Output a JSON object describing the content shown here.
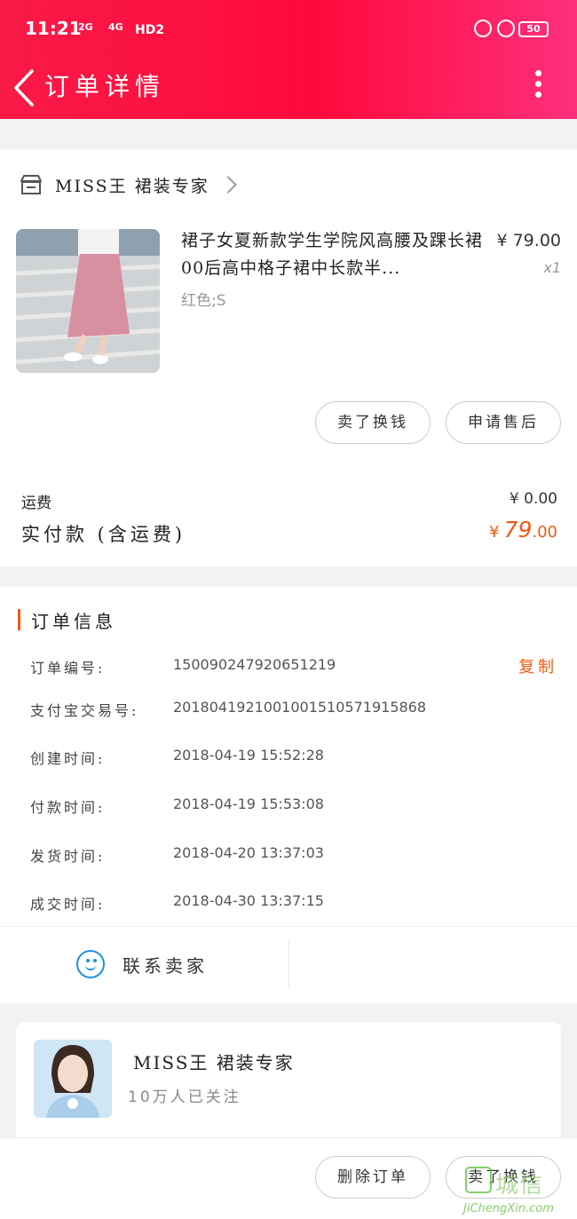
{
  "status_bar": {
    "time": "11:21",
    "signal1": "2G",
    "signal2": "4G",
    "hd": "HD2",
    "battery": "50"
  },
  "nav": {
    "title": "订单详情"
  },
  "store": {
    "name": "MISS王  裙装专家"
  },
  "product": {
    "title": "裙子女夏新款学生学院风高腰及踝长裙00后高中格子裙中长款半...",
    "sku": "红色;S",
    "price": "¥ 79.00",
    "qty": "x1",
    "buttons": [
      "卖了换钱",
      "申请售后"
    ]
  },
  "fees": {
    "shipping_label": "运费",
    "shipping_value": "¥ 0.00",
    "total_label": "实付款 (含运费)",
    "total_currency": "¥",
    "total_int": "79",
    "total_dec": ".00"
  },
  "order_info": {
    "title": "订单信息",
    "copy_label": "复制",
    "rows": [
      {
        "label": "订单编号:",
        "value": "150090247920651219"
      },
      {
        "label": "支付宝交易号:",
        "value": "2018041921001001510571915868"
      },
      {
        "label": "创建时间:",
        "value": "2018-04-19 15:52:28"
      },
      {
        "label": "付款时间:",
        "value": "2018-04-19 15:53:08"
      },
      {
        "label": "发货时间:",
        "value": "2018-04-20 13:37:03"
      },
      {
        "label": "成交时间:",
        "value": "2018-04-30 13:37:15"
      }
    ]
  },
  "contact": {
    "label": "联系卖家"
  },
  "seller": {
    "name": "MISS王  裙装专家",
    "fans": "10万人已关注"
  },
  "bottom": {
    "delete_label": "删除订单",
    "sell_label": "卖了换钱"
  },
  "watermark": {
    "text": "城信",
    "url": "JiChengXin.com"
  },
  "colors": {
    "header_red": "#ff0a3c",
    "accent_orange": "#f25a0f",
    "contact_blue": "#1e90e6"
  }
}
